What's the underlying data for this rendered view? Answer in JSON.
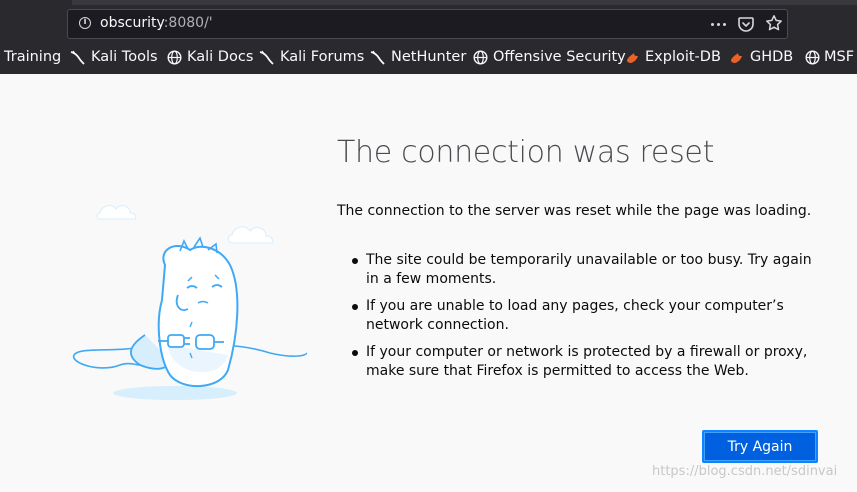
{
  "urlbar": {
    "host": "obscurity",
    "rest": ":8080/'"
  },
  "bookmarks": [
    {
      "label": "Training",
      "icon": "none"
    },
    {
      "label": "Kali Tools",
      "icon": "kali-dragon-icon"
    },
    {
      "label": "Kali Docs",
      "icon": "globe-icon"
    },
    {
      "label": "Kali Forums",
      "icon": "kali-dragon-icon"
    },
    {
      "label": "NetHunter",
      "icon": "kali-dragon-icon"
    },
    {
      "label": "Offensive Security",
      "icon": "globe-icon"
    },
    {
      "label": "Exploit-DB",
      "icon": "exploitdb-icon"
    },
    {
      "label": "GHDB",
      "icon": "exploitdb-icon"
    },
    {
      "label": "MSF",
      "icon": "globe-icon"
    }
  ],
  "error": {
    "title": "The connection was reset",
    "description": "The connection to the server was reset while the page was loading.",
    "bullets": [
      "The site could be temporarily unavailable or too busy. Try again in a few moments.",
      "If you are unable to load any pages, check your computer’s network connection.",
      "If your computer or network is protected by a firewall or proxy, make sure that Firefox is permitted to access the Web."
    ],
    "try_again_label": "Try Again"
  },
  "watermark": "https://blog.csdn.net/sdinvai",
  "colors": {
    "chrome_bg": "#2a2a2e",
    "page_bg": "#f9f9fa",
    "button_blue": "#0060df",
    "illustration_blue": "#3fa9f5"
  }
}
